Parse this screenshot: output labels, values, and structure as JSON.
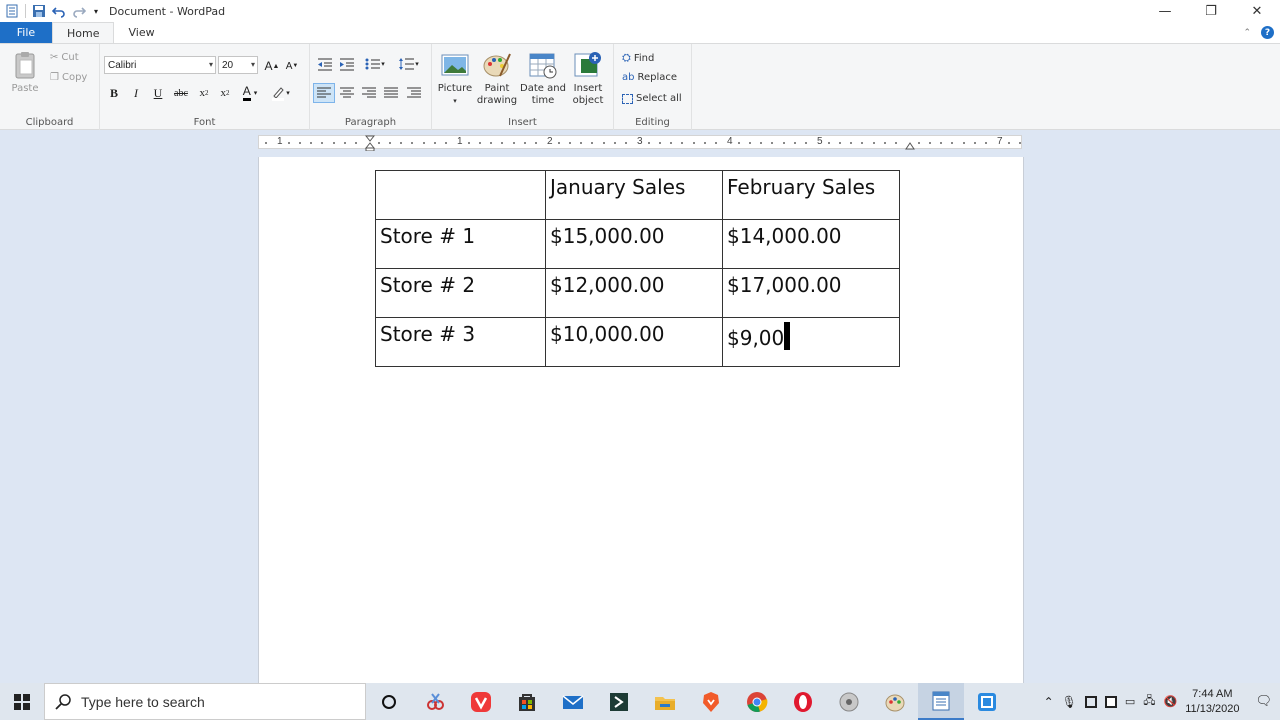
{
  "window": {
    "title": "Document - WordPad"
  },
  "tabs": {
    "file": "File",
    "home": "Home",
    "view": "View"
  },
  "clipboard": {
    "paste": "Paste",
    "cut": "Cut",
    "copy": "Copy",
    "label": "Clipboard"
  },
  "font": {
    "family": "Calibri",
    "size": "20",
    "label": "Font"
  },
  "paragraph": {
    "label": "Paragraph"
  },
  "insert": {
    "picture": "Picture",
    "paint_1": "Paint",
    "paint_2": "drawing",
    "date_1": "Date and",
    "date_2": "time",
    "object_1": "Insert",
    "object_2": "object",
    "label": "Insert"
  },
  "editing": {
    "find": "Find",
    "replace": "Replace",
    "select_all": "Select all",
    "label": "Editing"
  },
  "ruler": {
    "marks": [
      "1",
      "1",
      "2",
      "3",
      "4",
      "5",
      "7"
    ]
  },
  "table": {
    "rows": [
      [
        "",
        "January Sales",
        "February Sales"
      ],
      [
        "Store # 1",
        "$15,000.00",
        "$14,000.00"
      ],
      [
        "Store # 2",
        "$12,000.00",
        "$17,000.00"
      ],
      [
        "Store # 3",
        "$10,000.00",
        "$9,00"
      ]
    ]
  },
  "taskbar": {
    "search_placeholder": "Type here to search",
    "time": "7:44 AM",
    "date": "11/13/2020"
  },
  "colors": {
    "accent": "#1e6fc7",
    "selected": "#cde4f7",
    "workspace": "#dde6f3"
  }
}
